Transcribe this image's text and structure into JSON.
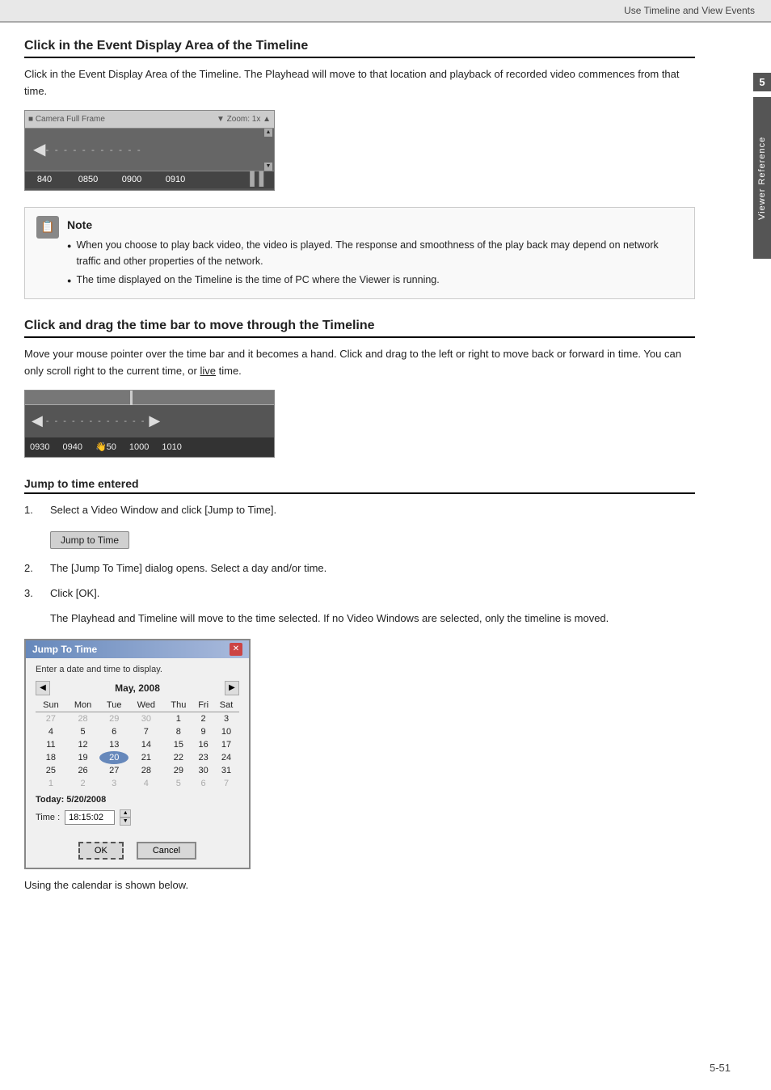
{
  "header": {
    "title": "Use Timeline and View Events"
  },
  "side_tab": {
    "number": "5",
    "label": "Viewer Reference"
  },
  "section1": {
    "heading": "Click in the Event Display Area of the Timeline",
    "para": "Click in the Event Display Area of the Timeline. The Playhead will move to that location and playback of recorded video commences from that time."
  },
  "note": {
    "title": "Note",
    "bullet1": "When you choose to play back video, the video is played. The response and smoothness of the play back may depend on network traffic and other properties of the network.",
    "bullet2": "The time displayed on the Timeline is the time of PC where the Viewer is running."
  },
  "section2": {
    "heading": "Click and drag the time bar to move through the Timeline",
    "para1": "Move your mouse pointer over the time bar and it becomes a hand. Click and drag to the left or right to move back or forward in time. You can only scroll right to the current time, or",
    "live_text": "live",
    "para2": "time."
  },
  "timeline1": {
    "footer_times": [
      "840",
      "0850",
      "0900",
      "0910"
    ]
  },
  "timeline2": {
    "footer_times": [
      "0930",
      "0940",
      "0❐50",
      "1000",
      "1010"
    ]
  },
  "section3": {
    "heading": "Jump to time entered",
    "step1": "Select a Video Window and click [Jump to Time].",
    "button_label": "Jump to Time",
    "step2": "The [Jump To Time] dialog opens. Select a day and/or time.",
    "step3": "Click [OK].",
    "step3_detail": "The Playhead and Timeline will move to the time selected. If no Video Windows are selected, only the timeline is moved."
  },
  "dialog": {
    "title": "Jump To Time",
    "subtitle": "Enter a date and time to display.",
    "month": "May, 2008",
    "days_header": [
      "Sun",
      "Mon",
      "Tue",
      "Wed",
      "Thu",
      "Fri",
      "Sat"
    ],
    "week1": [
      "27",
      "28",
      "29",
      "30",
      "1",
      "2",
      "3"
    ],
    "week2": [
      "4",
      "5",
      "6",
      "7",
      "8",
      "9",
      "10"
    ],
    "week3": [
      "11",
      "12",
      "13",
      "14",
      "15",
      "16",
      "17"
    ],
    "week4": [
      "18",
      "19",
      "20",
      "21",
      "22",
      "23",
      "24"
    ],
    "week5": [
      "25",
      "26",
      "27",
      "28",
      "29",
      "30",
      "31"
    ],
    "week6": [
      "1",
      "2",
      "3",
      "4",
      "5",
      "6",
      "7"
    ],
    "today_label": "Today: 5/20/2008",
    "time_label": "Time :",
    "time_value": "18:15:02",
    "ok_label": "OK",
    "cancel_label": "Cancel",
    "today_day": "20"
  },
  "footer": {
    "using_text": "Using the calendar is shown below.",
    "page_number": "5-51"
  }
}
